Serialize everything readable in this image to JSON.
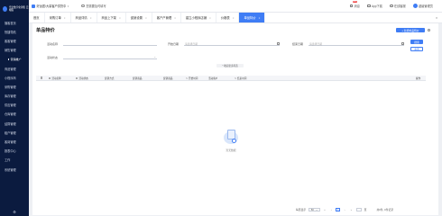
{
  "sidebar": {
    "logo_text": "乐企数字化销售 云端版",
    "items": [
      {
        "label": "播客首页"
      },
      {
        "label": "快捷导航"
      },
      {
        "label": "客客管理"
      },
      {
        "label": "销售管理"
      },
      {
        "label": "营销推广"
      },
      {
        "label": "商品管理"
      },
      {
        "label": "小程序商"
      },
      {
        "label": "采购管理"
      },
      {
        "label": "库存管理"
      },
      {
        "label": "供应管理"
      },
      {
        "label": "仓库管理"
      },
      {
        "label": "结算管理"
      },
      {
        "label": "租户管理"
      },
      {
        "label": "客岗管理"
      },
      {
        "label": "报表中心"
      },
      {
        "label": "工作"
      },
      {
        "label": "系统管理"
      }
    ],
    "sub_item": "营销推广"
  },
  "topbar": {
    "store_a": "好运居/大量客户供货中",
    "store_b": "东营",
    "notice": "您需要及时填写",
    "messages": "消息",
    "badge": "99+",
    "app_download": "App下载",
    "online_service": "在线客服",
    "user": "超级管理员"
  },
  "tabs": [
    {
      "label": "首页",
      "closable": false
    },
    {
      "label": "采购订单",
      "closable": true
    },
    {
      "label": "商品详情",
      "closable": true
    },
    {
      "label": "商品上下架",
      "closable": true
    },
    {
      "label": "促销设置",
      "closable": true
    },
    {
      "label": "客户户管理",
      "closable": true
    },
    {
      "label": "建立小程序店铺",
      "closable": true
    },
    {
      "label": "价格表",
      "closable": true
    },
    {
      "label": "单品特价",
      "closable": true,
      "active": true
    }
  ],
  "page": {
    "title": "单品特价",
    "add_button": "+ 新增单品特价",
    "search_button": "搜索",
    "reset_button": "重置"
  },
  "filters": {
    "activity_name": {
      "label": "活动名称",
      "placeholder": ""
    },
    "start_date": {
      "label": "开始日期",
      "placeholder": "请选择日期"
    },
    "end_date": {
      "label": "结束日期",
      "placeholder": "请选择日期"
    },
    "activity_status": {
      "label": "活动状态",
      "placeholder": ""
    },
    "toggle": "^ 收起更多筛选"
  },
  "table": {
    "columns": [
      "活动名称",
      "活动状态",
      "促销方式",
      "促销商品",
      "促销商品",
      "开始时间",
      "活动客户",
      "结束时间",
      "操作"
    ],
    "empty_text": "暂无数据"
  },
  "pager": {
    "per_page_label": "每页显示",
    "per_page": "50",
    "current_page": "1",
    "goto_label": "页",
    "total": "共0条, 0条记录"
  }
}
